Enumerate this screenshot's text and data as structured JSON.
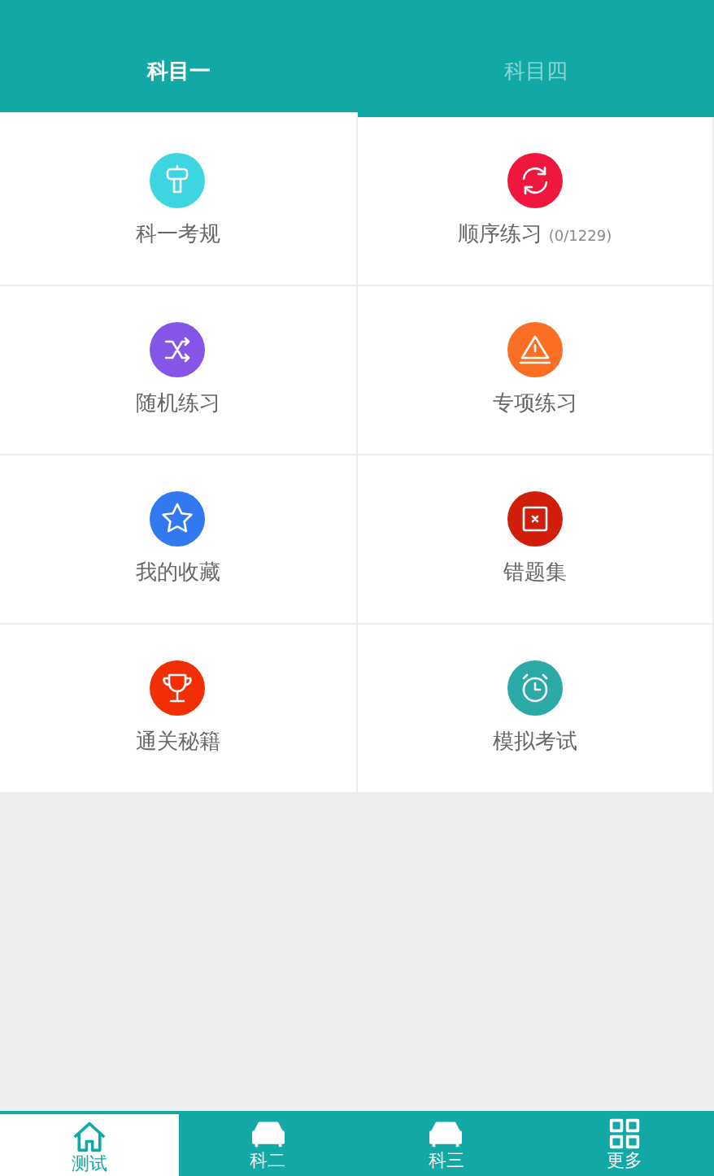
{
  "tabs": [
    {
      "label": "科目一",
      "selected": true
    },
    {
      "label": "科目四",
      "selected": false
    }
  ],
  "menu": [
    {
      "label": "科一考规",
      "kind": "sign",
      "color": "#3dd6e0"
    },
    {
      "label": "顺序练习",
      "count": "(0/1229)",
      "kind": "cycle",
      "color": "#f0173f"
    },
    {
      "label": "随机练习",
      "kind": "shuffle",
      "color": "#8455e6"
    },
    {
      "label": "专项练习",
      "kind": "warning",
      "color": "#fb6f25"
    },
    {
      "label": "我的收藏",
      "kind": "star",
      "color": "#3278ef"
    },
    {
      "label": "错题集",
      "kind": "cross",
      "color": "#d01e0b"
    },
    {
      "label": "通关秘籍",
      "kind": "trophy",
      "color": "#f12e06"
    },
    {
      "label": "模拟考试",
      "kind": "clock",
      "color": "#2ba9a7"
    }
  ],
  "bottom_nav": [
    {
      "label": "测试",
      "kind": "home",
      "selected": true
    },
    {
      "label": "科二",
      "kind": "car",
      "selected": false
    },
    {
      "label": "科三",
      "kind": "car",
      "selected": false
    },
    {
      "label": "更多",
      "kind": "grid",
      "selected": false
    }
  ]
}
